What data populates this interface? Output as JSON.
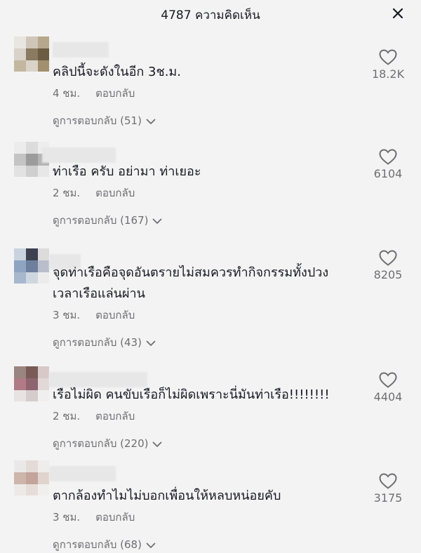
{
  "header": {
    "title": "4787 ความคิดเห็น",
    "close_icon": "close-icon"
  },
  "comments": [
    {
      "text": "คลิปนี้จะดังในอีก 3ช.ม.",
      "time": "4 ชม.",
      "reply_label": "ตอบกลับ",
      "view_replies": "ดูการตอบกลับ (51)",
      "likes": "18.2K",
      "avatar_colors": [
        "#e9e6e1",
        "#cfc6b8",
        "#b7a78d",
        "#d8d2c8",
        "#8a7a5f",
        "#6b5c43",
        "#c3b79f",
        "#d9d3c9",
        "#a18f6e"
      ]
    },
    {
      "text": "ท่าเรือ ครับ อย่ามา ท่าเยอะ",
      "time": "2 ชม.",
      "reply_label": "ตอบกลับ",
      "view_replies": "ดูการตอบกลับ (167)",
      "likes": "6104",
      "avatar_colors": [
        "#ececec",
        "#dcdcdc",
        "#ededed",
        "#c4c4c4",
        "#9c9c9c",
        "#b5b5b5",
        "#e2e2e2",
        "#cfcfcf",
        "#e7e7e7"
      ]
    },
    {
      "text": "จุดท่าเรือคือจุดอันตรายไม่สมควรทำกิจกรรมทั้งปวง",
      "text2": "เวลาเรือแล่นผ่าน",
      "time": "3 ชม.",
      "reply_label": "ตอบกลับ",
      "view_replies": "ดูการตอบกลับ (43)",
      "likes": "8205",
      "avatar_colors": [
        "#c9d3dd",
        "#3d4150",
        "#dcdcdc",
        "#8ea4c0",
        "#6d7f9d",
        "#b9bfca",
        "#a7b7cc",
        "#d0d6de",
        "#ececec"
      ]
    },
    {
      "text": "เรือไม่ผิด คนขับเรือก็ไม่ผิดเพราะนี่มันท่าเรือ!!!!!!!!",
      "time": "2 ชม.",
      "reply_label": "ตอบกลับ",
      "view_replies": "ดูการตอบกลับ (220)",
      "likes": "4404",
      "avatar_colors": [
        "#9b8580",
        "#7a5a57",
        "#d6c9c7",
        "#b07a87",
        "#8d6570",
        "#e1d8d8",
        "#e7e3e3",
        "#d5cdcd",
        "#efefef"
      ]
    },
    {
      "text": "ตากล้องทำไมไม่บอกเพื่อนให้หลบหน่อยคับ",
      "time": "3 ชม.",
      "reply_label": "ตอบกลับ",
      "view_replies": "ดูการตอบกลับ (68)",
      "likes": "3175",
      "avatar_colors": [
        "#ebe9e7",
        "#e5dbd6",
        "#efedeb",
        "#cdb5ac",
        "#c2a49b",
        "#e0d4cf",
        "#ede9e6",
        "#e6ddd9",
        "#f0efed"
      ]
    }
  ]
}
